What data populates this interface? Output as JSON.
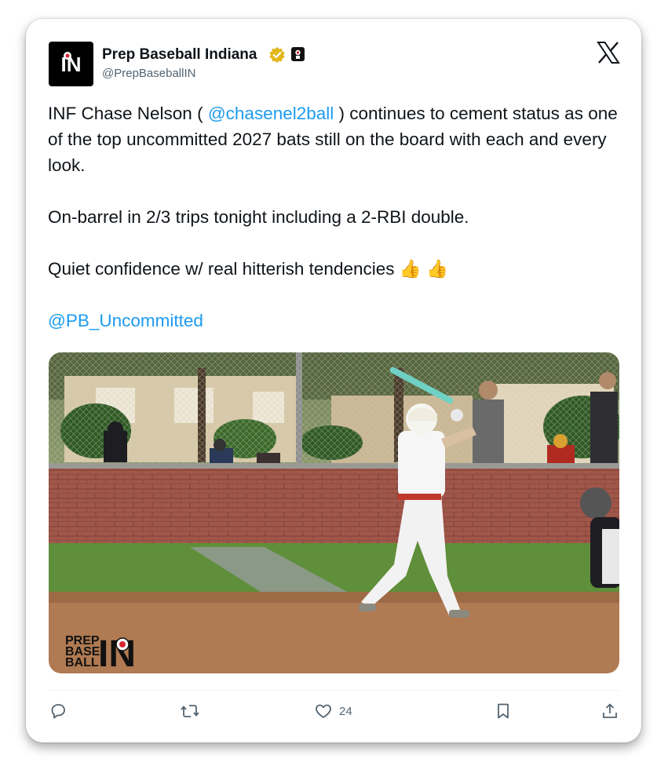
{
  "tweet": {
    "display_name": "Prep Baseball Indiana",
    "handle": "@PrepBaseballIN",
    "avatar_text": "IN",
    "line1_prefix": "INF Chase Nelson ( ",
    "mention1": "@chasenel2ball",
    "line1_suffix": " ) continues to cement status as one of the top uncommitted 2027 bats still on the board with each and every look.",
    "para2": "On-barrel in 2/3 trips tonight including a 2-RBI double.",
    "para3": "Quiet confidence w/ real hitterish tendencies 👍 👍",
    "mention2": "@PB_Uncommitted"
  },
  "media": {
    "watermark_line1": "PREP",
    "watermark_line2": "BASE",
    "watermark_line3": "BALL",
    "watermark_in": "IN"
  },
  "actions": {
    "like_count": "24"
  },
  "icons": [
    "verified-badge-icon",
    "affiliate-badge-icon",
    "x-logo-icon",
    "reply-icon",
    "retweet-icon",
    "like-icon",
    "bookmark-icon",
    "share-icon"
  ],
  "colors": {
    "link": "#1d9bf0",
    "verified": "#e2b719",
    "muted": "#536471"
  }
}
